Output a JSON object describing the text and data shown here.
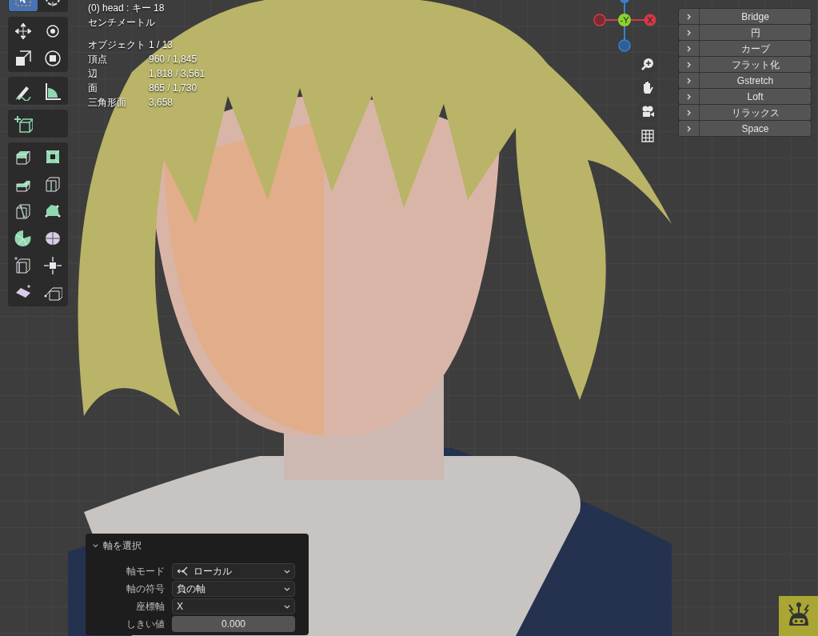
{
  "viewport_info": {
    "object_line": "(0) head : キー 18",
    "units": "センチメートル"
  },
  "stats": [
    {
      "label": "オブジェクト",
      "value": "1 / 13"
    },
    {
      "label": "頂点",
      "value": "960 / 1,845"
    },
    {
      "label": "辺",
      "value": "1,818 / 3,561"
    },
    {
      "label": "面",
      "value": "865 / 1,730"
    },
    {
      "label": "三角形面",
      "value": "3,658"
    }
  ],
  "toolbar": [
    [
      {
        "kind": "select",
        "selected": true
      },
      {
        "kind": "cursor",
        "selected": false
      }
    ],
    [
      {
        "kind": "move",
        "selected": false
      },
      {
        "kind": "rotate",
        "selected": false
      },
      {
        "kind": "scale",
        "selected": false
      },
      {
        "kind": "transform",
        "selected": false
      }
    ],
    [
      {
        "kind": "annotate",
        "selected": false
      },
      {
        "kind": "measure",
        "selected": false
      }
    ],
    [
      {
        "kind": "add_cube",
        "selected": false
      }
    ],
    [
      {
        "kind": "extrude",
        "selected": false
      },
      {
        "kind": "inset",
        "selected": false
      },
      {
        "kind": "bevel",
        "selected": false
      },
      {
        "kind": "loop_cut",
        "selected": false
      },
      {
        "kind": "knife",
        "selected": false
      },
      {
        "kind": "poly_build",
        "selected": false
      },
      {
        "kind": "spin",
        "selected": false
      },
      {
        "kind": "smooth",
        "selected": false
      },
      {
        "kind": "edge_slide",
        "selected": false
      },
      {
        "kind": "shrink",
        "selected": false
      },
      {
        "kind": "shear",
        "selected": false
      },
      {
        "kind": "rip",
        "selected": false
      }
    ]
  ],
  "gizmo": {
    "y": "-Y",
    "x": "X"
  },
  "tool_panel": [
    {
      "label": "Bridge",
      "expanded": false
    },
    {
      "label": "円",
      "expanded": false
    },
    {
      "label": "カーブ",
      "expanded": false
    },
    {
      "label": "フラット化",
      "expanded": false
    },
    {
      "label": "Gstretch",
      "expanded": false
    },
    {
      "label": "Loft",
      "expanded": false
    },
    {
      "label": "リラックス",
      "expanded": false
    },
    {
      "label": "Space",
      "expanded": false
    }
  ],
  "operator_panel": {
    "title": "軸を選択",
    "expanded": true,
    "fields": [
      {
        "kind": "dropdown",
        "label": "軸モード",
        "value": "ローカル",
        "icon": true
      },
      {
        "kind": "dropdown",
        "label": "軸の符号",
        "value": "負の軸",
        "icon": false
      },
      {
        "kind": "dropdown",
        "label": "座標軸",
        "value": "X",
        "icon": false
      },
      {
        "kind": "number",
        "label": "しきい値",
        "value": "0.000"
      }
    ]
  }
}
